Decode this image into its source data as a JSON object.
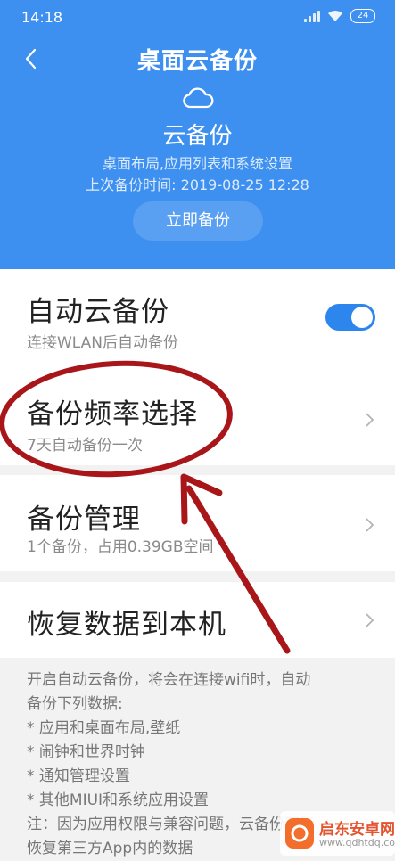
{
  "status_bar": {
    "time": "14:18",
    "battery": "24"
  },
  "header": {
    "title": "桌面云备份",
    "hero_title": "云备份",
    "description": "桌面布局,应用列表和系统设置",
    "last_backup": "上次备份时间: 2019-08-25 12:28",
    "backup_now_label": "立即备份",
    "background_color": "#3d8ff0"
  },
  "settings": [
    {
      "title": "自动云备份",
      "subtitle": "连接WLAN后自动备份",
      "control": "toggle",
      "enabled": true
    },
    {
      "title": "备份频率选择",
      "subtitle": "7天自动备份一次",
      "control": "chevron"
    },
    {
      "title": "备份管理",
      "subtitle": "1个备份，占用0.39GB空间",
      "control": "chevron"
    },
    {
      "title": "恢复数据到本机",
      "subtitle": "",
      "control": "chevron"
    }
  ],
  "notes": [
    "开启自动云备份，将会在连接wifi时，自动",
    "备份下列数据:",
    "*  应用和桌面布局,壁纸",
    "*  闹钟和世界时钟",
    "*  通知管理设置",
    "*  其他MIUI和系统应用设置",
    "注：因为应用权限与兼容问题，云备份不能",
    "恢复第三方App内的数据"
  ],
  "watermark": {
    "name": "启东安卓网",
    "url": "www.qdhtdq.com"
  },
  "colors": {
    "accent": "#2c86ee",
    "annotation": "#a8161a"
  }
}
